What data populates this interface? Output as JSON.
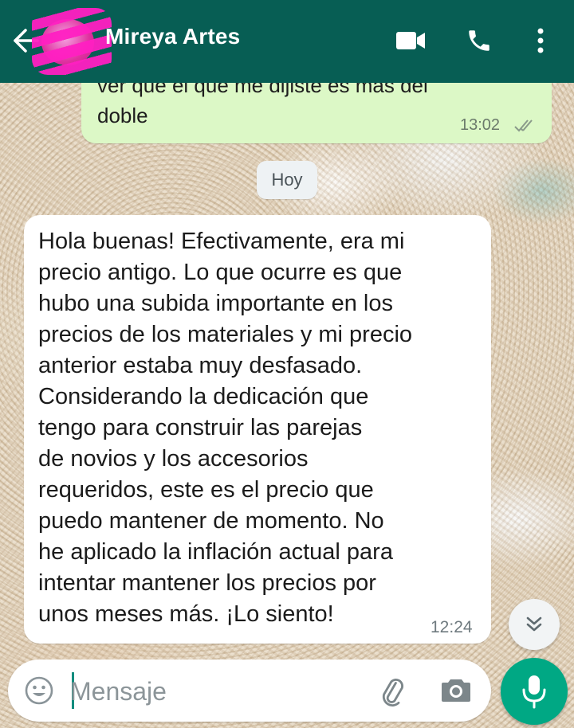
{
  "header": {
    "contact_name": "Mireya Artes",
    "icons": [
      "back-arrow-icon",
      "video-call-icon",
      "phone-icon",
      "more-vert-icon"
    ],
    "background_color": "#075e54"
  },
  "messages": [
    {
      "direction": "outgoing",
      "partial_line": "ver que el que me dijiste es más del",
      "text": "doble",
      "time": "13:02",
      "status": "read"
    },
    {
      "direction": "incoming",
      "text": "Hola buenas!  Efectivamente, era mi\nprecio antigo. Lo que ocurre es que\nhubo una subida importante en los\nprecios de los materiales y mi precio\nanterior estaba muy desfasado.\nConsiderando la dedicación que\ntengo para construir las parejas\nde novios  y los accesorios\nrequeridos, este es el precio que\npuedo mantener de momento. No\nhe aplicado la inflación actual para\nintentar mantener los precios por\nunos meses más. ¡Lo siento!",
      "time": "12:24"
    }
  ],
  "day_separator": "Hoy",
  "composer": {
    "placeholder": "Mensaje",
    "value": ""
  },
  "colors": {
    "outgoing_bubble": "#dcf8c6",
    "incoming_bubble": "#ffffff",
    "accent": "#00a884"
  }
}
